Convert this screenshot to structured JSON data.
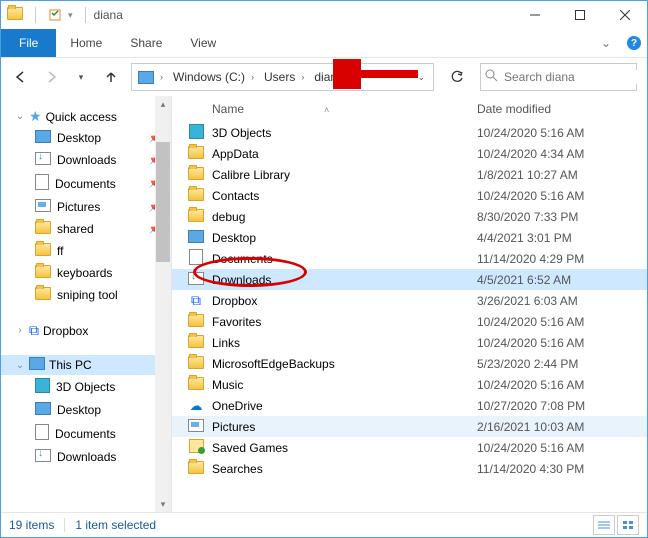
{
  "title": "diana",
  "ribbon": {
    "file": "File",
    "tabs": [
      "Home",
      "Share",
      "View"
    ]
  },
  "breadcrumb": [
    "Windows (C:)",
    "Users",
    "diana"
  ],
  "search": {
    "placeholder": "Search diana"
  },
  "nav": {
    "quick_access": {
      "label": "Quick access",
      "items": [
        {
          "label": "Desktop",
          "icon": "desktop",
          "pinned": true
        },
        {
          "label": "Downloads",
          "icon": "downloads",
          "pinned": true
        },
        {
          "label": "Documents",
          "icon": "doc",
          "pinned": true
        },
        {
          "label": "Pictures",
          "icon": "pic",
          "pinned": true
        },
        {
          "label": "shared",
          "icon": "folder",
          "pinned": true
        },
        {
          "label": "ff",
          "icon": "folder",
          "pinned": false
        },
        {
          "label": "keyboards",
          "icon": "folder",
          "pinned": false
        },
        {
          "label": "sniping tool",
          "icon": "folder",
          "pinned": false
        }
      ]
    },
    "dropbox": {
      "label": "Dropbox"
    },
    "this_pc": {
      "label": "This PC",
      "items": [
        {
          "label": "3D Objects",
          "icon": "threed"
        },
        {
          "label": "Desktop",
          "icon": "desktop"
        },
        {
          "label": "Documents",
          "icon": "doc"
        },
        {
          "label": "Downloads",
          "icon": "downloads"
        }
      ]
    }
  },
  "columns": {
    "name": "Name",
    "date": "Date modified"
  },
  "files": [
    {
      "name": "3D Objects",
      "date": "10/24/2020 5:16 AM",
      "icon": "threed"
    },
    {
      "name": "AppData",
      "date": "10/24/2020 4:34 AM",
      "icon": "folder"
    },
    {
      "name": "Calibre Library",
      "date": "1/8/2021 10:27 AM",
      "icon": "folder"
    },
    {
      "name": "Contacts",
      "date": "10/24/2020 5:16 AM",
      "icon": "folder"
    },
    {
      "name": "debug",
      "date": "8/30/2020 7:33 PM",
      "icon": "folder"
    },
    {
      "name": "Desktop",
      "date": "4/4/2021 3:01 PM",
      "icon": "desktop"
    },
    {
      "name": "Documents",
      "date": "11/14/2020 4:29 PM",
      "icon": "doc"
    },
    {
      "name": "Downloads",
      "date": "4/5/2021 6:52 AM",
      "icon": "downloads",
      "selected": true
    },
    {
      "name": "Dropbox",
      "date": "3/26/2021 6:03 AM",
      "icon": "dropbox"
    },
    {
      "name": "Favorites",
      "date": "10/24/2020 5:16 AM",
      "icon": "folder"
    },
    {
      "name": "Links",
      "date": "10/24/2020 5:16 AM",
      "icon": "folder"
    },
    {
      "name": "MicrosoftEdgeBackups",
      "date": "5/23/2020 2:44 PM",
      "icon": "folder"
    },
    {
      "name": "Music",
      "date": "10/24/2020 5:16 AM",
      "icon": "folder"
    },
    {
      "name": "OneDrive",
      "date": "10/27/2020 7:08 PM",
      "icon": "cloud"
    },
    {
      "name": "Pictures",
      "date": "2/16/2021 10:03 AM",
      "icon": "pic",
      "highlight": true
    },
    {
      "name": "Saved Games",
      "date": "10/24/2020 5:16 AM",
      "icon": "saved"
    },
    {
      "name": "Searches",
      "date": "11/14/2020 4:30 PM",
      "icon": "folder"
    }
  ],
  "status": {
    "count": "19 items",
    "selected": "1 item selected"
  }
}
